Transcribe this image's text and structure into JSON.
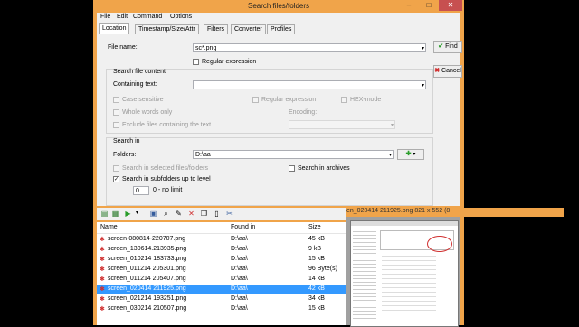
{
  "window": {
    "title": "Search files/folders",
    "min": "–",
    "max": "□",
    "close": "✕"
  },
  "menu": [
    "File",
    "Edit",
    "Command",
    "Options"
  ],
  "tabs": [
    "Location",
    "Timestamp/Size/Attr",
    "Filters",
    "Converter",
    "Profiles"
  ],
  "location": {
    "file_name_label": "File name:",
    "file_name_value": "sc*.png",
    "regex_label": "Regular expression",
    "find_label": "Find",
    "cancel_label": "Cancel"
  },
  "content": {
    "group_title": "Search file content",
    "containing_label": "Containing text:",
    "containing_value": "",
    "case_sensitive": "Case sensitive",
    "regex": "Regular expression",
    "hex": "HEX-mode",
    "whole_words": "Whole words only",
    "encoding": "Encoding:",
    "exclude": "Exclude files containing the text"
  },
  "search_in": {
    "group_title": "Search in",
    "folders_label": "Folders:",
    "folders_value": "D:\\aa",
    "selected_files": "Search in selected files/folders",
    "archives": "Search in archives",
    "subfolders": "Search in subfolders up to level",
    "level_value": "0",
    "no_limit": "0 - no limit"
  },
  "results": {
    "columns": [
      "Name",
      "Found in",
      "Size"
    ],
    "rows": [
      {
        "name": "screen-080814-220707.png",
        "found": "D:\\aa\\",
        "size": "45 kB"
      },
      {
        "name": "screen_130614.213935.png",
        "found": "D:\\aa\\",
        "size": "9 kB"
      },
      {
        "name": "screen_010214 183733.png",
        "found": "D:\\aa\\",
        "size": "15 kB"
      },
      {
        "name": "screen_011214 205301.png",
        "found": "D:\\aa\\",
        "size": "96 Byte(s)"
      },
      {
        "name": "screen_011214 205407.png",
        "found": "D:\\aa\\",
        "size": "14 kB"
      },
      {
        "name": "screen_020414 211925.png",
        "found": "D:\\aa\\",
        "size": "42 kB"
      },
      {
        "name": "screen_021214 193251.png",
        "found": "D:\\aa\\",
        "size": "34 kB"
      },
      {
        "name": "screen_030214 210507.png",
        "found": "D:\\aa\\",
        "size": "15 kB"
      }
    ],
    "selected_index": 5
  },
  "preview": {
    "caption": "en_020414 211925.png   821 x 552 (8"
  },
  "colors": {
    "accent": "#3399ff",
    "window_frame": "#f0a44a",
    "find_icon": "#2a9d2a",
    "cancel_icon": "#d03030"
  }
}
